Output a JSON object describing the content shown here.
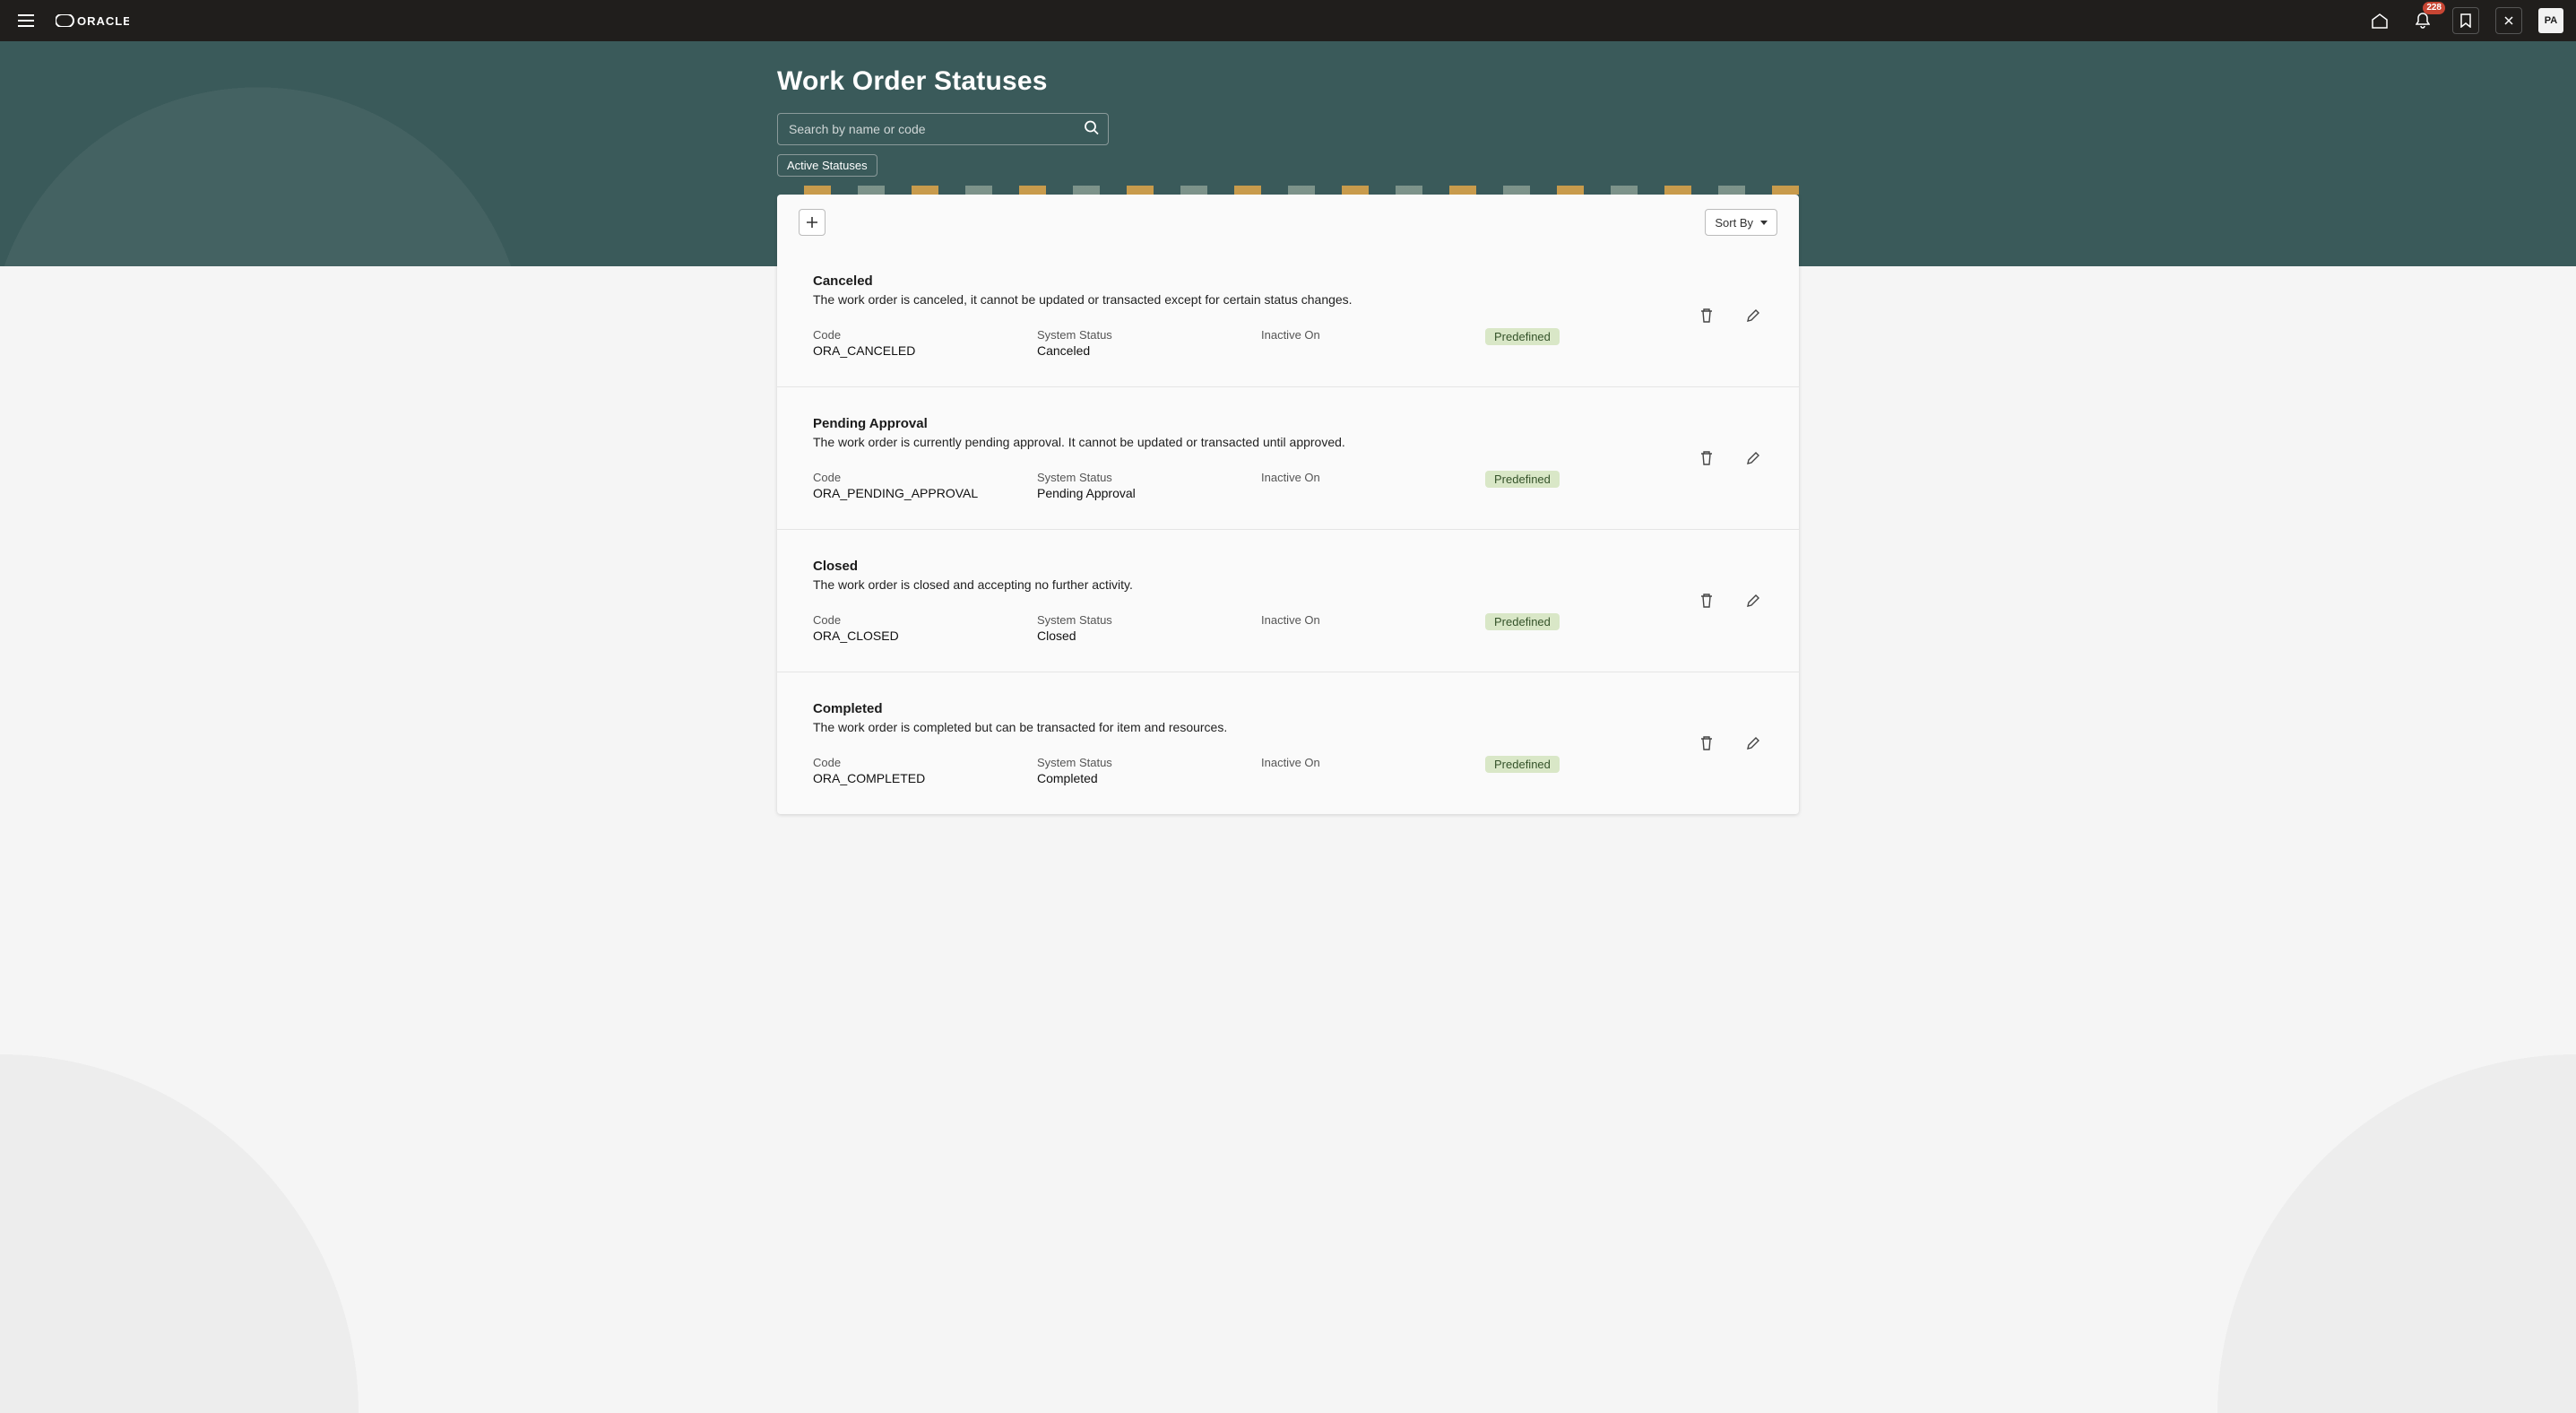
{
  "topbar": {
    "brand": "ORACLE",
    "notification_count": "228",
    "avatar_initials": "PA"
  },
  "page": {
    "title": "Work Order Statuses",
    "search_placeholder": "Search by name or code",
    "filter_chip": "Active Statuses",
    "sort_label": "Sort By"
  },
  "labels": {
    "code": "Code",
    "system_status": "System Status",
    "inactive_on": "Inactive On",
    "predefined": "Predefined"
  },
  "statuses": [
    {
      "name": "Canceled",
      "description": "The work order is canceled, it cannot be updated or transacted except for certain status changes.",
      "code": "ORA_CANCELED",
      "system_status": "Canceled",
      "inactive_on": "",
      "predefined": true
    },
    {
      "name": "Pending Approval",
      "description": "The work order is currently pending approval. It cannot be updated or transacted until approved.",
      "code": "ORA_PENDING_APPROVAL",
      "system_status": "Pending Approval",
      "inactive_on": "",
      "predefined": true
    },
    {
      "name": "Closed",
      "description": "The work order is closed and accepting no further activity.",
      "code": "ORA_CLOSED",
      "system_status": "Closed",
      "inactive_on": "",
      "predefined": true
    },
    {
      "name": "Completed",
      "description": "The work order is completed but can be transacted for item and resources.",
      "code": "ORA_COMPLETED",
      "system_status": "Completed",
      "inactive_on": "",
      "predefined": true
    }
  ]
}
